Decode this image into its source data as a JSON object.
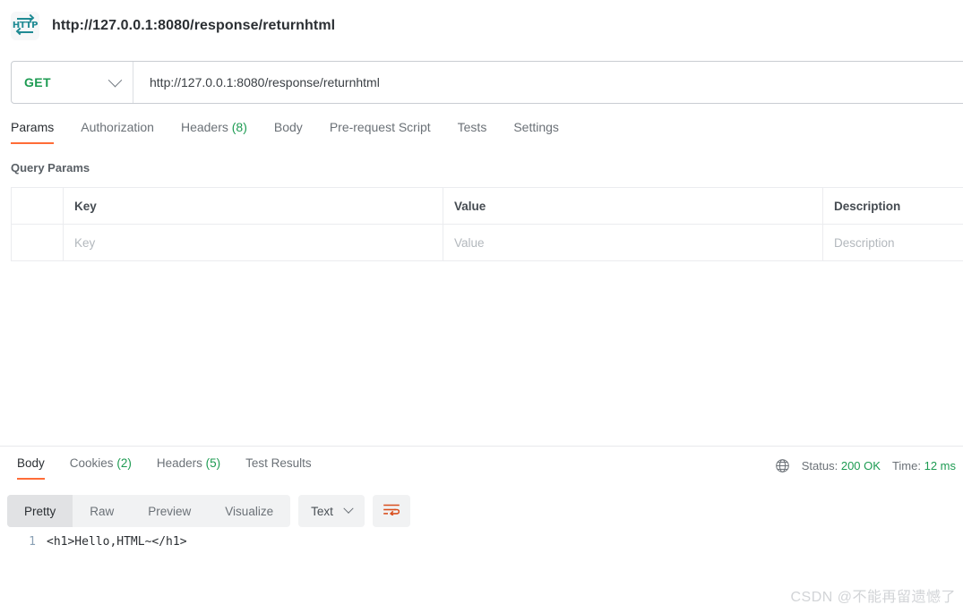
{
  "titlebar": {
    "icon_name": "http-protocol-icon",
    "icon_text": "HTTP",
    "title": "http://127.0.0.1:8080/response/returnhtml"
  },
  "request_bar": {
    "method": "GET",
    "url": "http://127.0.0.1:8080/response/returnhtml",
    "method_color": "#1d9b52"
  },
  "request_tabs": [
    {
      "label": "Params",
      "count": "",
      "active": true
    },
    {
      "label": "Authorization",
      "count": "",
      "active": false
    },
    {
      "label": "Headers",
      "count": "(8)",
      "active": false
    },
    {
      "label": "Body",
      "count": "",
      "active": false
    },
    {
      "label": "Pre-request Script",
      "count": "",
      "active": false
    },
    {
      "label": "Tests",
      "count": "",
      "active": false
    },
    {
      "label": "Settings",
      "count": "",
      "active": false
    }
  ],
  "query_params": {
    "section_title": "Query Params",
    "headers": [
      "",
      "Key",
      "Value",
      "Description"
    ],
    "rows": [
      {
        "key_placeholder": "Key",
        "value_placeholder": "Value",
        "description_placeholder": "Description"
      }
    ]
  },
  "response_tabs": [
    {
      "label": "Body",
      "count": "",
      "active": true
    },
    {
      "label": "Cookies",
      "count": "(2)",
      "active": false
    },
    {
      "label": "Headers",
      "count": "(5)",
      "active": false
    },
    {
      "label": "Test Results",
      "count": "",
      "active": false
    }
  ],
  "response_meta": {
    "globe_icon": "globe-icon",
    "status_label": "Status:",
    "status_value": "200 OK",
    "time_label": "Time:",
    "time_value": "12 ms",
    "value_color": "#1d9b52"
  },
  "body_toolbar": {
    "views": [
      {
        "label": "Pretty",
        "active": true
      },
      {
        "label": "Raw",
        "active": false
      },
      {
        "label": "Preview",
        "active": false
      },
      {
        "label": "Visualize",
        "active": false
      }
    ],
    "format": "Text",
    "wrap_icon": "word-wrap-icon",
    "wrap_icon_color": "#d94f1e"
  },
  "response_body": {
    "lines": [
      {
        "number": "1",
        "code": "<h1>Hello,HTML~</h1>"
      }
    ]
  },
  "watermark": {
    "text": "CSDN @不能再留遗憾了"
  },
  "accent": {
    "orange": "#ff6c37",
    "green": "#1d9b52",
    "teal": "#1f8a93"
  }
}
